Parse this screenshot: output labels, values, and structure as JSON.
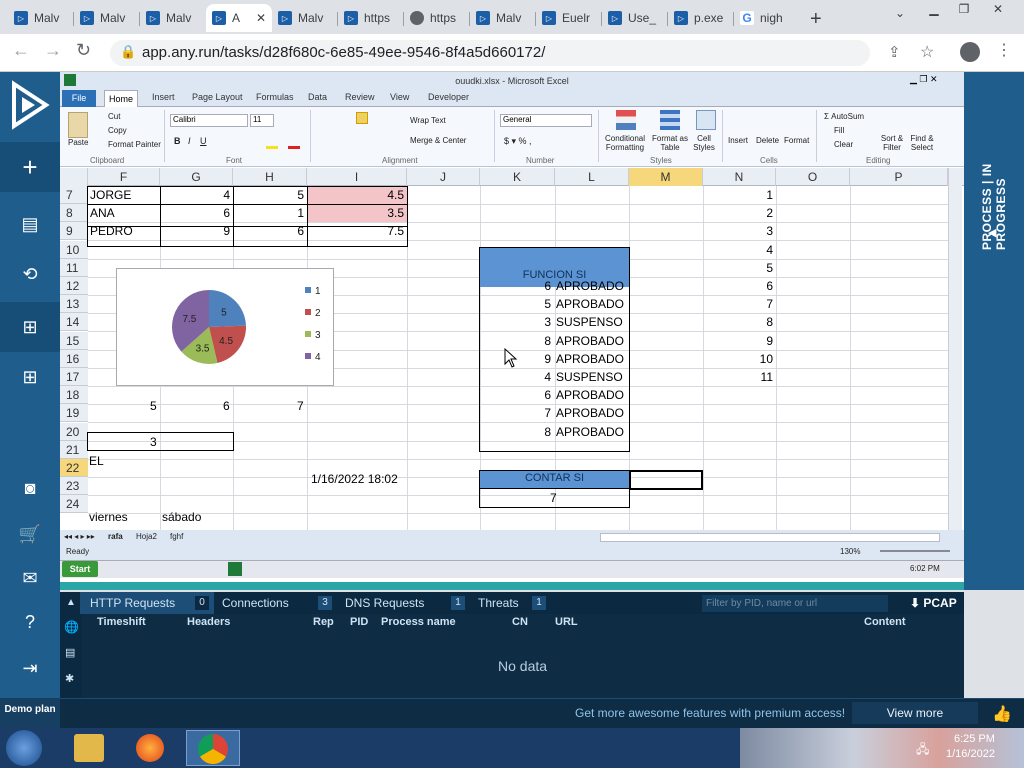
{
  "browser": {
    "tabs": [
      {
        "label": "Malv",
        "icon": "anyrun-icon"
      },
      {
        "label": "Malv",
        "icon": "anyrun-icon"
      },
      {
        "label": "Malv",
        "icon": "anyrun-icon"
      },
      {
        "label": "A",
        "icon": "anyrun-icon",
        "active": true
      },
      {
        "label": "Malv",
        "icon": "anyrun-icon"
      },
      {
        "label": "https",
        "icon": "anyrun-icon"
      },
      {
        "label": "https",
        "icon": "globe-icon"
      },
      {
        "label": "Malv",
        "icon": "anyrun-icon"
      },
      {
        "label": "Euelr",
        "icon": "anyrun-icon"
      },
      {
        "label": "Use_",
        "icon": "anyrun-icon"
      },
      {
        "label": "p.exe",
        "icon": "anyrun-icon"
      },
      {
        "label": "nigh",
        "icon": "google-icon"
      }
    ],
    "url": "app.any.run/tasks/d28f680c-6e85-49ee-9546-8f4a5d660172/"
  },
  "sidebar_right": {
    "status": "PROCESS | IN PROGRESS"
  },
  "excel": {
    "title": "ouudki.xlsx - Microsoft Excel",
    "ribbon_tabs": [
      "File",
      "Home",
      "Insert",
      "Page Layout",
      "Formulas",
      "Data",
      "Review",
      "View",
      "Developer"
    ],
    "clipboard": {
      "paste": "Paste",
      "cut": "Cut",
      "copy": "Copy",
      "format_painter": "Format Painter",
      "group": "Clipboard"
    },
    "font": {
      "name": "Calibri",
      "size": "11",
      "group": "Font"
    },
    "alignment": {
      "wrap": "Wrap Text",
      "merge": "Merge & Center",
      "group": "Alignment"
    },
    "number": {
      "format": "General",
      "group": "Number"
    },
    "styles": {
      "cond": "Conditional Formatting",
      "table": "Format as Table",
      "cell": "Cell Styles",
      "group": "Styles"
    },
    "cells": {
      "insert": "Insert",
      "delete": "Delete",
      "format": "Format",
      "group": "Cells"
    },
    "editing": {
      "autosum": "AutoSum",
      "fill": "Fill",
      "clear": "Clear",
      "sort": "Sort & Filter",
      "find": "Find & Select",
      "group": "Editing"
    },
    "columns": [
      "F",
      "G",
      "H",
      "I",
      "J",
      "K",
      "L",
      "M",
      "N",
      "O",
      "P"
    ],
    "rows": [
      "7",
      "8",
      "9",
      "10",
      "11",
      "12",
      "13",
      "14",
      "15",
      "16",
      "17",
      "18",
      "19",
      "20",
      "21",
      "22",
      "23",
      "24"
    ],
    "table_rows": [
      {
        "name": "JORGE",
        "g": "4",
        "h": "5",
        "i": "4.5"
      },
      {
        "name": "ANA",
        "g": "6",
        "h": "1",
        "i": "3.5"
      },
      {
        "name": "PEDRO",
        "g": "9",
        "h": "6",
        "i": "7.5"
      }
    ],
    "funcion_header": "FUNCION SI",
    "funcion_rows": [
      {
        "n": "6",
        "r": "APROBADO"
      },
      {
        "n": "5",
        "r": "APROBADO"
      },
      {
        "n": "3",
        "r": "SUSPENSO"
      },
      {
        "n": "8",
        "r": "APROBADO"
      },
      {
        "n": "9",
        "r": "APROBADO"
      },
      {
        "n": "4",
        "r": "SUSPENSO"
      },
      {
        "n": "6",
        "r": "APROBADO"
      },
      {
        "n": "7",
        "r": "APROBADO"
      },
      {
        "n": "8",
        "r": "APROBADO"
      }
    ],
    "n_column": [
      "1",
      "2",
      "3",
      "4",
      "5",
      "6",
      "7",
      "8",
      "9",
      "10",
      "11"
    ],
    "row18": [
      "5",
      "6",
      "7"
    ],
    "row20": "3",
    "row21": "EL",
    "datetime": "1/16/2022 18:02",
    "contar_header": "CONTAR SI",
    "contar_value": "7",
    "row24": [
      "viernes",
      "sábado"
    ],
    "sheets": [
      "rafa",
      "Hoja2",
      "fghf"
    ],
    "status": "Ready",
    "zoom": "130%",
    "xp_start": "Start",
    "xp_clock": "6:02 PM"
  },
  "chart_data": {
    "type": "pie",
    "categories": [
      "1",
      "2",
      "3",
      "4"
    ],
    "values": [
      5,
      4.5,
      3.5,
      7.5
    ],
    "labels": [
      "5",
      "4.5",
      "3.5",
      "7.5"
    ],
    "colors": [
      "#4f81bd",
      "#c0504d",
      "#9bbb59",
      "#8064a2"
    ],
    "legend": "right"
  },
  "panel": {
    "tabs": [
      {
        "label": "HTTP Requests",
        "count": "0"
      },
      {
        "label": "Connections",
        "count": "3"
      },
      {
        "label": "DNS Requests",
        "count": "1"
      },
      {
        "label": "Threats",
        "count": "1"
      }
    ],
    "filter_placeholder": "Filter by PID, name or url",
    "pcap": "PCAP",
    "headers": [
      "Timeshift",
      "Headers",
      "Rep",
      "PID",
      "Process name",
      "CN",
      "URL",
      "Content"
    ],
    "empty": "No data"
  },
  "premium": {
    "demo": "Demo plan",
    "text": "Get more awesome features with premium access!",
    "button": "View more"
  },
  "taskbar": {
    "time": "6:25 PM",
    "date": "1/16/2022"
  }
}
